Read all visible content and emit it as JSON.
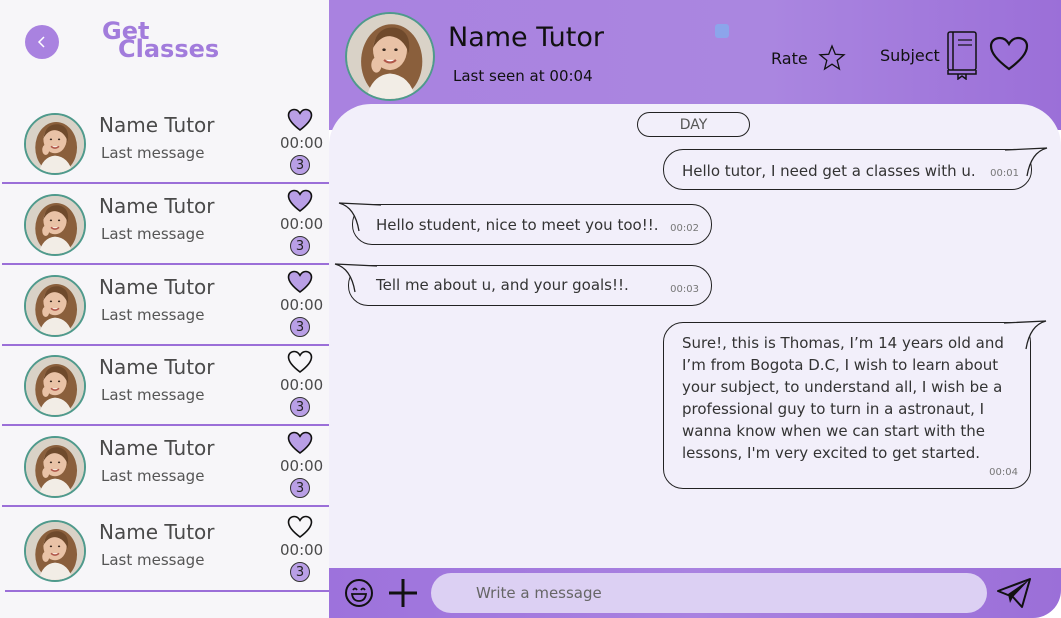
{
  "brand": {
    "line1": "Get",
    "line2": "Classes"
  },
  "contacts": [
    {
      "name": "Name Tutor",
      "last_message": "Last message",
      "time": "00:00",
      "unread": "3",
      "favorite": true
    },
    {
      "name": "Name Tutor",
      "last_message": "Last message",
      "time": "00:00",
      "unread": "3",
      "favorite": true
    },
    {
      "name": "Name Tutor",
      "last_message": "Last message",
      "time": "00:00",
      "unread": "3",
      "favorite": true
    },
    {
      "name": "Name Tutor",
      "last_message": "Last message",
      "time": "00:00",
      "unread": "3",
      "favorite": false
    },
    {
      "name": "Name Tutor",
      "last_message": "Last message",
      "time": "00:00",
      "unread": "3",
      "favorite": true
    },
    {
      "name": "Name Tutor",
      "last_message": "Last message",
      "time": "00:00",
      "unread": "3",
      "favorite": false
    }
  ],
  "header": {
    "tutor_name": "Name Tutor",
    "last_seen": "Last seen at 00:04",
    "rate_label": "Rate",
    "subject_label": "Subject"
  },
  "chat": {
    "day_label": "DAY",
    "messages": [
      {
        "from": "student",
        "text": "Hello tutor, I need get a classes with u.",
        "time": "00:01"
      },
      {
        "from": "tutor",
        "text": "Hello student, nice to meet you too!!.",
        "time": "00:02"
      },
      {
        "from": "tutor",
        "text": "Tell me about u, and your goals!!.",
        "time": "00:03"
      },
      {
        "from": "student",
        "text": "Sure!, this is Thomas, I’m 14 years old and I’m from Bogota D.C, I wish to learn about your subject, to understand all, I wish be a professional guy to turn in a astronaut, I wanna know when we can start with the lessons, I'm very excited to get started.",
        "time": "00:04"
      }
    ]
  },
  "composer": {
    "placeholder": "Write a message"
  },
  "colors": {
    "accent": "#a982e0",
    "accent_dark": "#9b6fd8",
    "chat_bg": "#f2effa",
    "input_bg": "#dcd0f3",
    "heart_fill": "#b99fe6"
  },
  "icons": {
    "back": "chevron-left-icon",
    "star": "star-icon",
    "subject": "book-icon",
    "favorite": "heart-icon",
    "emoji": "smile-icon",
    "add": "plus-icon",
    "send": "send-icon"
  }
}
